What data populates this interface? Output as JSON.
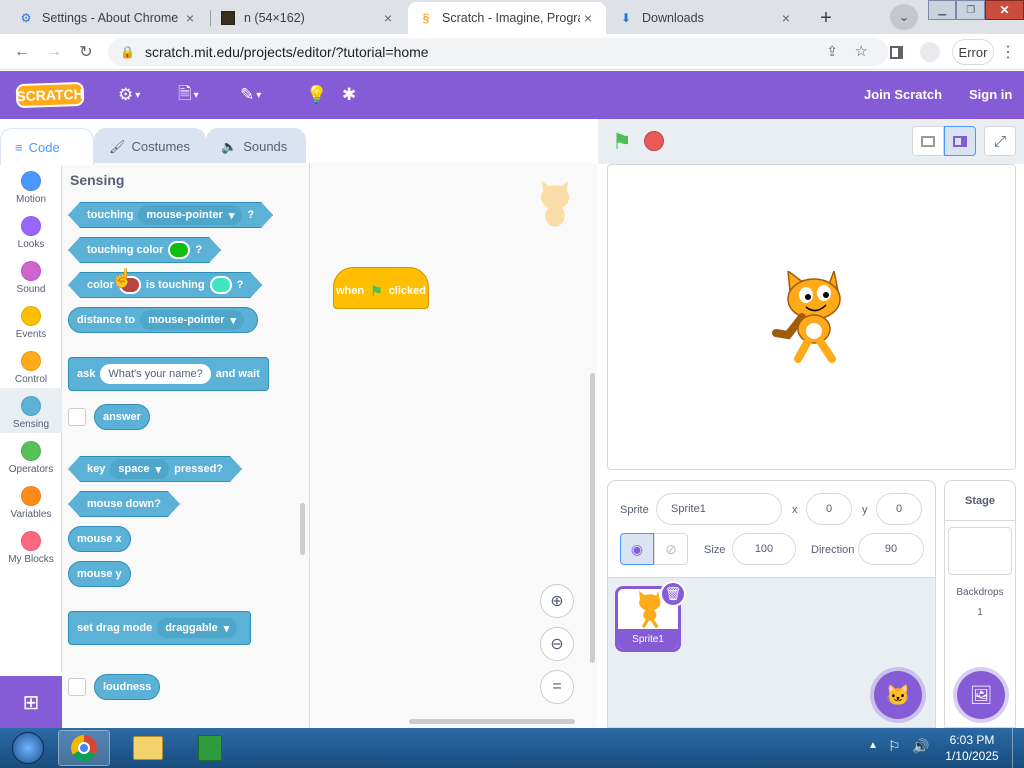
{
  "browser": {
    "tabs": [
      {
        "title": "Settings - About Chrome",
        "icon": "gear-icon"
      },
      {
        "title": "n (54×162)",
        "icon": "image-icon"
      },
      {
        "title": "Scratch - Imagine, Progra",
        "icon": "scratch-icon"
      },
      {
        "title": "Downloads",
        "icon": "download-icon"
      }
    ],
    "url": "scratch.mit.edu/projects/editor/?tutorial=home",
    "profile_button": "Error"
  },
  "menubar": {
    "logo": "SCRATCH",
    "join": "Join Scratch",
    "signin": "Sign in"
  },
  "editor_tabs": [
    "Code",
    "Costumes",
    "Sounds"
  ],
  "categories": [
    {
      "label": "Motion",
      "color": "#4c97ff"
    },
    {
      "label": "Looks",
      "color": "#9966ff"
    },
    {
      "label": "Sound",
      "color": "#cf63cf"
    },
    {
      "label": "Events",
      "color": "#ffbf00"
    },
    {
      "label": "Control",
      "color": "#ffab19"
    },
    {
      "label": "Sensing",
      "color": "#5cb1d6"
    },
    {
      "label": "Operators",
      "color": "#59c059"
    },
    {
      "label": "Variables",
      "color": "#ff8c1a"
    },
    {
      "label": "My Blocks",
      "color": "#ff6680"
    }
  ],
  "palette": {
    "heading": "Sensing",
    "touching": {
      "text": "touching",
      "menu": "mouse-pointer",
      "end": "?"
    },
    "touching_color": {
      "text": "touching color",
      "end": "?"
    },
    "color_touching": {
      "a": "color",
      "b": "is touching",
      "end": "?"
    },
    "distance": {
      "text": "distance to",
      "menu": "mouse-pointer"
    },
    "ask": {
      "a": "ask",
      "slot": "What's your name?",
      "b": "and wait"
    },
    "answer": "answer",
    "key": {
      "a": "key",
      "menu": "space",
      "b": "pressed?"
    },
    "mouse_down": "mouse down?",
    "mouse_x": "mouse x",
    "mouse_y": "mouse y",
    "drag": {
      "text": "set drag mode",
      "menu": "draggable"
    },
    "loudness": "loudness"
  },
  "script": {
    "a": "when",
    "b": "clicked"
  },
  "sprite_info": {
    "sprite_label": "Sprite",
    "sprite_name": "Sprite1",
    "x_label": "x",
    "x": "0",
    "y_label": "y",
    "y": "0",
    "size_label": "Size",
    "size": "100",
    "direction_label": "Direction",
    "direction": "90"
  },
  "sprite_list": [
    {
      "name": "Sprite1"
    }
  ],
  "stage_panel": {
    "title": "Stage",
    "backdrops_label": "Backdrops",
    "backdrops_count": "1"
  },
  "taskbar": {
    "time": "6:03 PM",
    "date": "1/10/2025"
  },
  "colors": {
    "scratch_purple": "#855cd6",
    "sensing": "#5cb1d6",
    "events": "#ffbf00",
    "accent_blue": "#4c97ff"
  }
}
